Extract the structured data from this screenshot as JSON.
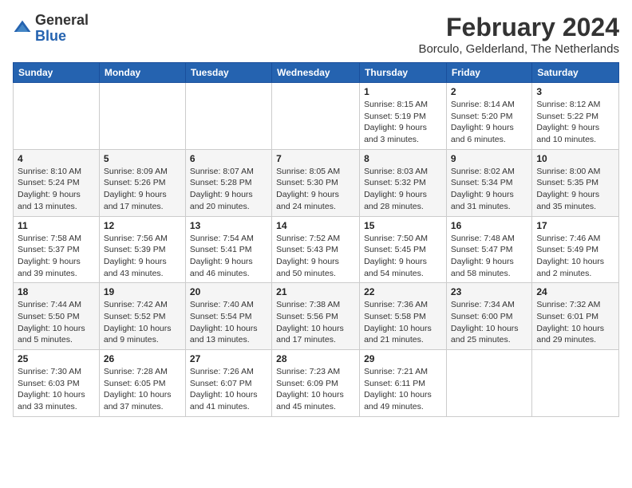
{
  "header": {
    "logo_general": "General",
    "logo_blue": "Blue",
    "month_year": "February 2024",
    "location": "Borculo, Gelderland, The Netherlands"
  },
  "weekdays": [
    "Sunday",
    "Monday",
    "Tuesday",
    "Wednesday",
    "Thursday",
    "Friday",
    "Saturday"
  ],
  "weeks": [
    [
      {
        "day": "",
        "info": ""
      },
      {
        "day": "",
        "info": ""
      },
      {
        "day": "",
        "info": ""
      },
      {
        "day": "",
        "info": ""
      },
      {
        "day": "1",
        "info": "Sunrise: 8:15 AM\nSunset: 5:19 PM\nDaylight: 9 hours\nand 3 minutes."
      },
      {
        "day": "2",
        "info": "Sunrise: 8:14 AM\nSunset: 5:20 PM\nDaylight: 9 hours\nand 6 minutes."
      },
      {
        "day": "3",
        "info": "Sunrise: 8:12 AM\nSunset: 5:22 PM\nDaylight: 9 hours\nand 10 minutes."
      }
    ],
    [
      {
        "day": "4",
        "info": "Sunrise: 8:10 AM\nSunset: 5:24 PM\nDaylight: 9 hours\nand 13 minutes."
      },
      {
        "day": "5",
        "info": "Sunrise: 8:09 AM\nSunset: 5:26 PM\nDaylight: 9 hours\nand 17 minutes."
      },
      {
        "day": "6",
        "info": "Sunrise: 8:07 AM\nSunset: 5:28 PM\nDaylight: 9 hours\nand 20 minutes."
      },
      {
        "day": "7",
        "info": "Sunrise: 8:05 AM\nSunset: 5:30 PM\nDaylight: 9 hours\nand 24 minutes."
      },
      {
        "day": "8",
        "info": "Sunrise: 8:03 AM\nSunset: 5:32 PM\nDaylight: 9 hours\nand 28 minutes."
      },
      {
        "day": "9",
        "info": "Sunrise: 8:02 AM\nSunset: 5:34 PM\nDaylight: 9 hours\nand 31 minutes."
      },
      {
        "day": "10",
        "info": "Sunrise: 8:00 AM\nSunset: 5:35 PM\nDaylight: 9 hours\nand 35 minutes."
      }
    ],
    [
      {
        "day": "11",
        "info": "Sunrise: 7:58 AM\nSunset: 5:37 PM\nDaylight: 9 hours\nand 39 minutes."
      },
      {
        "day": "12",
        "info": "Sunrise: 7:56 AM\nSunset: 5:39 PM\nDaylight: 9 hours\nand 43 minutes."
      },
      {
        "day": "13",
        "info": "Sunrise: 7:54 AM\nSunset: 5:41 PM\nDaylight: 9 hours\nand 46 minutes."
      },
      {
        "day": "14",
        "info": "Sunrise: 7:52 AM\nSunset: 5:43 PM\nDaylight: 9 hours\nand 50 minutes."
      },
      {
        "day": "15",
        "info": "Sunrise: 7:50 AM\nSunset: 5:45 PM\nDaylight: 9 hours\nand 54 minutes."
      },
      {
        "day": "16",
        "info": "Sunrise: 7:48 AM\nSunset: 5:47 PM\nDaylight: 9 hours\nand 58 minutes."
      },
      {
        "day": "17",
        "info": "Sunrise: 7:46 AM\nSunset: 5:49 PM\nDaylight: 10 hours\nand 2 minutes."
      }
    ],
    [
      {
        "day": "18",
        "info": "Sunrise: 7:44 AM\nSunset: 5:50 PM\nDaylight: 10 hours\nand 5 minutes."
      },
      {
        "day": "19",
        "info": "Sunrise: 7:42 AM\nSunset: 5:52 PM\nDaylight: 10 hours\nand 9 minutes."
      },
      {
        "day": "20",
        "info": "Sunrise: 7:40 AM\nSunset: 5:54 PM\nDaylight: 10 hours\nand 13 minutes."
      },
      {
        "day": "21",
        "info": "Sunrise: 7:38 AM\nSunset: 5:56 PM\nDaylight: 10 hours\nand 17 minutes."
      },
      {
        "day": "22",
        "info": "Sunrise: 7:36 AM\nSunset: 5:58 PM\nDaylight: 10 hours\nand 21 minutes."
      },
      {
        "day": "23",
        "info": "Sunrise: 7:34 AM\nSunset: 6:00 PM\nDaylight: 10 hours\nand 25 minutes."
      },
      {
        "day": "24",
        "info": "Sunrise: 7:32 AM\nSunset: 6:01 PM\nDaylight: 10 hours\nand 29 minutes."
      }
    ],
    [
      {
        "day": "25",
        "info": "Sunrise: 7:30 AM\nSunset: 6:03 PM\nDaylight: 10 hours\nand 33 minutes."
      },
      {
        "day": "26",
        "info": "Sunrise: 7:28 AM\nSunset: 6:05 PM\nDaylight: 10 hours\nand 37 minutes."
      },
      {
        "day": "27",
        "info": "Sunrise: 7:26 AM\nSunset: 6:07 PM\nDaylight: 10 hours\nand 41 minutes."
      },
      {
        "day": "28",
        "info": "Sunrise: 7:23 AM\nSunset: 6:09 PM\nDaylight: 10 hours\nand 45 minutes."
      },
      {
        "day": "29",
        "info": "Sunrise: 7:21 AM\nSunset: 6:11 PM\nDaylight: 10 hours\nand 49 minutes."
      },
      {
        "day": "",
        "info": ""
      },
      {
        "day": "",
        "info": ""
      }
    ]
  ]
}
